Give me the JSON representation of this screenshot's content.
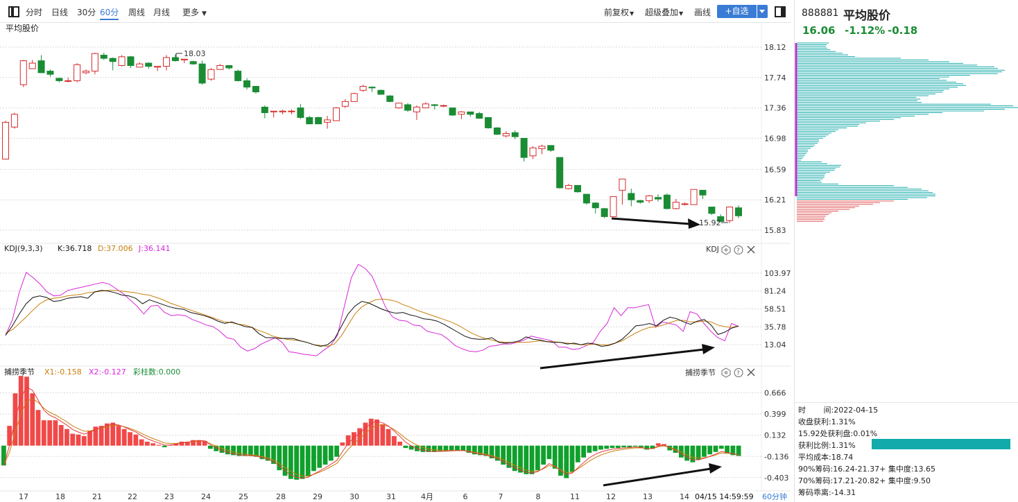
{
  "toolbar": {
    "periods": [
      "分时",
      "日线",
      "30分",
      "60分",
      "周线",
      "月线"
    ],
    "active_period": "60分",
    "more_label": "更多",
    "fq_label": "前复权",
    "overlay_label": "超级叠加",
    "draw_label": "画线",
    "add_label": "+自选"
  },
  "price_panel": {
    "title": "平均股价",
    "yticks": [
      "18.12",
      "17.74",
      "17.36",
      "16.98",
      "16.59",
      "16.21",
      "15.83"
    ],
    "high_label": "18.03",
    "low_label": "15.92"
  },
  "kdj_panel": {
    "name": "KDJ(9,3,3)",
    "k_label": "K:36.718",
    "d_label": "D:37.006",
    "j_label": "J:36.141",
    "tag": "KDJ",
    "yticks": [
      "103.97",
      "81.24",
      "58.51",
      "35.78",
      "13.04"
    ]
  },
  "cz_panel": {
    "name": "捕捞季节",
    "x1_label": "X1:-0.158",
    "x2_label": "X2:-0.127",
    "bar_label": "彩柱数:0.000",
    "tag": "捕捞季节",
    "yticks": [
      "0.666",
      "0.399",
      "0.132",
      "-0.136",
      "-0.403"
    ]
  },
  "xaxis": {
    "labels": [
      "17",
      "18",
      "21",
      "22",
      "23",
      "24",
      "25",
      "28",
      "29",
      "30",
      "31",
      "4月",
      "6",
      "7",
      "8",
      "11",
      "12",
      "13",
      "14"
    ],
    "cursor_time": "04/15  14:59:59",
    "period_label": "60分钟"
  },
  "colors": {
    "up": "#d42b2b",
    "down": "#1a8c34",
    "k": "#111111",
    "d": "#c87f0a",
    "j": "#d926d9",
    "cyan": "#16a9a9",
    "bar_red": "#f14848",
    "bar_green": "#10a02c",
    "accent": "#3a7bd5"
  },
  "chart_data": {
    "type": "candlestick",
    "title": "平均股价",
    "ylim": [
      15.83,
      18.12
    ],
    "candles": [
      [
        16.72,
        17.18,
        16.72,
        17.2
      ],
      [
        17.12,
        17.28,
        17.1,
        17.3
      ],
      [
        17.65,
        17.95,
        17.62,
        17.96
      ],
      [
        17.85,
        17.92,
        17.85,
        17.96
      ],
      [
        17.95,
        17.8,
        17.8,
        18.02
      ],
      [
        17.82,
        17.78,
        17.75,
        17.84
      ],
      [
        17.73,
        17.7,
        17.68,
        17.74
      ],
      [
        17.7,
        17.7,
        17.68,
        17.74
      ],
      [
        17.7,
        17.9,
        17.68,
        17.92
      ],
      [
        17.8,
        17.82,
        17.78,
        17.84
      ],
      [
        17.82,
        18.04,
        17.78,
        18.05
      ],
      [
        18.02,
        17.98,
        17.96,
        18.05
      ],
      [
        17.98,
        17.94,
        17.83,
        17.99
      ],
      [
        17.89,
        18.0,
        17.88,
        18.02
      ],
      [
        18.0,
        17.89,
        17.86,
        18.01
      ],
      [
        17.87,
        17.91,
        17.87,
        17.93
      ],
      [
        17.92,
        17.88,
        17.85,
        17.93
      ],
      [
        17.87,
        17.88,
        17.82,
        17.88
      ],
      [
        17.88,
        17.99,
        17.83,
        18.02
      ],
      [
        17.99,
        17.95,
        17.94,
        18.03
      ],
      [
        17.96,
        17.97,
        17.92,
        17.97
      ],
      [
        17.94,
        17.91,
        17.9,
        17.95
      ],
      [
        17.91,
        17.67,
        17.65,
        17.95
      ],
      [
        17.72,
        17.84,
        17.7,
        17.86
      ],
      [
        17.84,
        17.89,
        17.84,
        17.91
      ],
      [
        17.89,
        17.86,
        17.84,
        17.89
      ],
      [
        17.82,
        17.7,
        17.69,
        17.84
      ],
      [
        17.7,
        17.62,
        17.59,
        17.73
      ],
      [
        17.63,
        17.56,
        17.54,
        17.63
      ],
      [
        17.37,
        17.3,
        17.23,
        17.39
      ],
      [
        17.31,
        17.32,
        17.24,
        17.32
      ],
      [
        17.31,
        17.32,
        17.28,
        17.34
      ],
      [
        17.32,
        17.32,
        17.28,
        17.34
      ],
      [
        17.36,
        17.24,
        17.22,
        17.41
      ],
      [
        17.24,
        17.16,
        17.16,
        17.26
      ],
      [
        17.24,
        17.16,
        17.16,
        17.25
      ],
      [
        17.18,
        17.21,
        17.1,
        17.26
      ],
      [
        17.2,
        17.36,
        17.2,
        17.37
      ],
      [
        17.38,
        17.44,
        17.36,
        17.47
      ],
      [
        17.44,
        17.54,
        17.44,
        17.55
      ],
      [
        17.58,
        17.63,
        17.56,
        17.65
      ],
      [
        17.62,
        17.61,
        17.56,
        17.63
      ],
      [
        17.58,
        17.53,
        17.53,
        17.59
      ],
      [
        17.51,
        17.44,
        17.43,
        17.52
      ],
      [
        17.36,
        17.42,
        17.35,
        17.42
      ],
      [
        17.4,
        17.33,
        17.31,
        17.42
      ],
      [
        17.31,
        17.37,
        17.21,
        17.39
      ],
      [
        17.36,
        17.41,
        17.36,
        17.43
      ],
      [
        17.4,
        17.39,
        17.34,
        17.41
      ],
      [
        17.39,
        17.39,
        17.37,
        17.4
      ],
      [
        17.36,
        17.27,
        17.26,
        17.36
      ],
      [
        17.28,
        17.31,
        17.22,
        17.32
      ],
      [
        17.31,
        17.28,
        17.25,
        17.31
      ],
      [
        17.29,
        17.23,
        17.23,
        17.31
      ],
      [
        17.24,
        17.11,
        17.1,
        17.24
      ],
      [
        17.11,
        17.03,
        17.02,
        17.12
      ],
      [
        17.01,
        17.04,
        16.99,
        17.07
      ],
      [
        17.05,
        17.0,
        16.97,
        17.08
      ],
      [
        16.98,
        16.74,
        16.69,
        16.98
      ],
      [
        16.76,
        16.86,
        16.72,
        16.88
      ],
      [
        16.85,
        16.88,
        16.78,
        16.9
      ],
      [
        16.89,
        16.83,
        16.81,
        16.89
      ],
      [
        16.74,
        16.36,
        16.35,
        16.74
      ],
      [
        16.35,
        16.39,
        16.34,
        16.41
      ],
      [
        16.39,
        16.31,
        16.3,
        16.39
      ],
      [
        16.28,
        16.17,
        16.15,
        16.28
      ],
      [
        16.17,
        16.11,
        16.04,
        16.18
      ],
      [
        16.1,
        16.0,
        15.98,
        16.11
      ],
      [
        16.0,
        16.25,
        16.0,
        16.25
      ],
      [
        16.33,
        16.47,
        16.15,
        16.47
      ],
      [
        16.29,
        16.21,
        16.13,
        16.35
      ],
      [
        16.2,
        16.18,
        16.16,
        16.21
      ],
      [
        16.2,
        16.26,
        16.17,
        16.27
      ],
      [
        16.24,
        16.22,
        16.19,
        16.28
      ],
      [
        16.27,
        16.1,
        16.09,
        16.29
      ],
      [
        16.1,
        16.18,
        16.09,
        16.22
      ],
      [
        16.16,
        16.16,
        16.14,
        16.18
      ],
      [
        16.15,
        16.34,
        16.15,
        16.34
      ],
      [
        16.33,
        16.27,
        16.22,
        16.33
      ],
      [
        16.12,
        16.04,
        16.02,
        16.12
      ],
      [
        16.0,
        15.94,
        15.93,
        16.03
      ],
      [
        15.95,
        16.12,
        15.92,
        16.12
      ],
      [
        16.11,
        16.01,
        15.98,
        16.14
      ]
    ],
    "kdj_ylim": [
      -9.7,
      126.7
    ],
    "k": [
      25,
      37,
      52,
      65,
      73,
      75,
      73,
      68,
      69,
      72,
      73,
      74,
      72,
      80,
      82,
      81,
      79,
      76,
      75,
      72,
      65,
      70,
      67,
      64,
      61,
      59,
      58,
      54,
      52,
      50,
      47,
      43,
      40,
      42,
      39,
      36,
      35,
      27,
      22,
      22,
      21,
      21,
      21,
      18,
      16,
      13,
      11,
      13,
      20,
      36,
      52,
      62,
      68,
      66,
      62,
      58,
      55,
      53,
      54,
      51,
      49,
      46,
      45,
      43,
      39,
      34,
      29,
      24,
      21,
      20,
      20,
      22,
      16,
      15,
      16,
      18,
      23,
      20,
      19,
      17,
      16,
      16,
      14,
      15,
      13,
      15,
      14,
      11,
      12,
      15,
      20,
      28,
      37,
      38,
      40,
      37,
      44,
      48,
      46,
      42,
      39,
      43,
      45,
      38,
      26,
      29,
      34,
      36.7
    ],
    "d": [
      28,
      32,
      40,
      48,
      57,
      65,
      70,
      72,
      73,
      75,
      76,
      77,
      79,
      80,
      81,
      82,
      82,
      81,
      80,
      79,
      77,
      76,
      73,
      70,
      66,
      63,
      60,
      57,
      54,
      51,
      48,
      45,
      42,
      41,
      39,
      38,
      35,
      31,
      28,
      24,
      22,
      20,
      19,
      18,
      16,
      13,
      12,
      11,
      14,
      24,
      38,
      52,
      61,
      66,
      70,
      71,
      70,
      68,
      64,
      61,
      57,
      54,
      51,
      48,
      45,
      42,
      38,
      33,
      28,
      24,
      21,
      19,
      17,
      16,
      16,
      16,
      16,
      17,
      18,
      17,
      17,
      16,
      15,
      14,
      13,
      13,
      14,
      13,
      13,
      15,
      18,
      23,
      28,
      32,
      35,
      36,
      38,
      41,
      44,
      44,
      42,
      42,
      43,
      42,
      38,
      36,
      35,
      37
    ],
    "j": [
      25,
      45,
      80,
      105,
      98,
      90,
      80,
      75,
      76,
      82,
      84,
      86,
      88,
      90,
      92,
      90,
      84,
      78,
      70,
      62,
      52,
      62,
      63,
      54,
      50,
      51,
      50,
      45,
      42,
      38,
      36,
      30,
      22,
      20,
      10,
      5,
      8,
      14,
      18,
      22,
      16,
      4,
      3,
      1,
      0,
      -1,
      6,
      12,
      25,
      62,
      98,
      115,
      110,
      100,
      80,
      60,
      48,
      44,
      43,
      38,
      37,
      30,
      28,
      26,
      20,
      12,
      8,
      5,
      4,
      6,
      11,
      12,
      14,
      14,
      16,
      19,
      24,
      22,
      20,
      18,
      10,
      10,
      7,
      8,
      12,
      16,
      30,
      40,
      60,
      50,
      60,
      60,
      62,
      64,
      35,
      42,
      40,
      38,
      30,
      55,
      52,
      40,
      30,
      22,
      18,
      40,
      36.1
    ],
    "cz_ylim": [
      -0.545,
      0.855
    ],
    "bars": [
      -0.25,
      0.25,
      0.66,
      0.88,
      0.87,
      0.66,
      0.45,
      0.32,
      0.32,
      0.32,
      0.26,
      0.21,
      0.15,
      0.14,
      0.12,
      0.19,
      0.24,
      0.25,
      0.28,
      0.29,
      0.25,
      0.21,
      0.17,
      0.14,
      0.08,
      0.05,
      0.03,
      0.01,
      -0.02,
      0.01,
      0.03,
      0.05,
      0.05,
      0.07,
      0.07,
      0.06,
      -0.04,
      -0.07,
      -0.09,
      -0.11,
      -0.12,
      -0.13,
      -0.13,
      -0.13,
      -0.14,
      -0.17,
      -0.19,
      -0.23,
      -0.31,
      -0.38,
      -0.42,
      -0.43,
      -0.42,
      -0.39,
      -0.32,
      -0.28,
      -0.24,
      -0.19,
      -0.14,
      0.04,
      0.13,
      0.17,
      0.22,
      0.29,
      0.34,
      0.33,
      0.27,
      0.21,
      0.12,
      0.05,
      -0.03,
      -0.05,
      -0.07,
      -0.08,
      -0.08,
      -0.08,
      -0.07,
      -0.07,
      -0.06,
      -0.06,
      -0.06,
      -0.09,
      -0.11,
      -0.12,
      -0.13,
      -0.16,
      -0.19,
      -0.24,
      -0.28,
      -0.32,
      -0.34,
      -0.36,
      -0.36,
      -0.31,
      -0.24,
      -0.17,
      -0.29,
      -0.38,
      -0.41,
      -0.33,
      -0.21,
      -0.15,
      -0.09,
      -0.07,
      -0.05,
      -0.04,
      -0.03,
      -0.03,
      -0.02,
      -0.02,
      -0.01,
      -0.03,
      -0.05,
      -0.04,
      0.03,
      0.02,
      -0.06,
      -0.09,
      -0.15,
      -0.19,
      -0.21,
      -0.18,
      -0.14,
      -0.11,
      -0.08,
      -0.04,
      -0.1,
      -0.12,
      -0.13
    ]
  },
  "right_panel": {
    "code": "888881",
    "name": "平均股价",
    "price": "16.06",
    "change_pct": "-1.12%",
    "change": "-0.18",
    "chip_levels": [
      [
        "high",
        0
      ],
      [
        "mid",
        0
      ]
    ],
    "info": [
      "时　　 间:2022-04-15",
      "收盘获利:1.31%",
      "15.92处获利盘:0.01%",
      "获利比例:1.31%",
      "平均成本:18.74",
      "90%筹码:16.24-21.37+ 集中度:13.65",
      "70%筹码:17.21-20.82+ 集中度:9.50",
      "筹码乖离:-14.31"
    ]
  }
}
